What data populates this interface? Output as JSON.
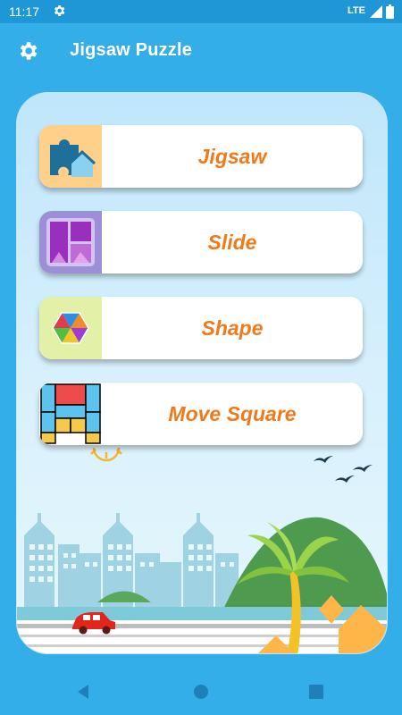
{
  "status_bar": {
    "time": "11:17",
    "network": "LTE"
  },
  "app_bar": {
    "title": "Jigsaw Puzzle",
    "settings_icon": "gear-icon"
  },
  "menu": {
    "items": [
      {
        "label": "Jigsaw",
        "icon": "jigsaw-piece-icon",
        "icon_bg": "#ffd08a"
      },
      {
        "label": "Slide",
        "icon": "slide-tiles-icon",
        "icon_bg": "#9d8fd6"
      },
      {
        "label": "Shape",
        "icon": "hexagon-triangles-icon",
        "icon_bg": "#e3f0a8"
      },
      {
        "label": "Move Square",
        "icon": "block-grid-icon",
        "icon_bg": "#ffffff"
      }
    ]
  },
  "colors": {
    "accent_text": "#f07a1a",
    "background": "#33aee8",
    "status_bar": "#1f97d6"
  },
  "nav_bar": {
    "back_icon": "back-triangle-icon",
    "home_icon": "home-circle-icon",
    "recents_icon": "recents-square-icon"
  }
}
